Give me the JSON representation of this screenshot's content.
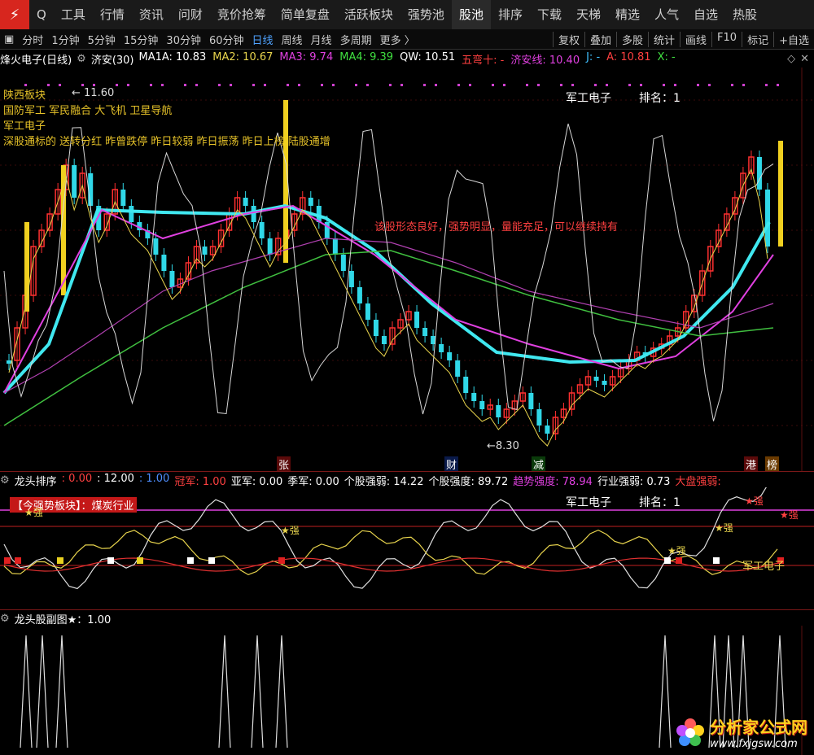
{
  "nav": {
    "logo_glyph": "⚡",
    "search_glyph": "Q",
    "items": [
      "工具",
      "行情",
      "资讯",
      "问财",
      "竞价抢筹",
      "简单复盘",
      "活跃板块",
      "强势池",
      "股池",
      "排序",
      "下载",
      "天梯",
      "精选",
      "人气",
      "自选",
      "热股"
    ],
    "active_index": 8
  },
  "toolbar": {
    "left": [
      "分时",
      "1分钟",
      "5分钟",
      "15分钟",
      "30分钟",
      "60分钟",
      "日线",
      "周线",
      "月线",
      "多周期",
      "更多 〉"
    ],
    "active_index": 6,
    "right": [
      "复权",
      "叠加",
      "多股",
      "统计",
      "画线",
      "F10",
      "标记",
      "+自选"
    ]
  },
  "main": {
    "title": "烽火电子(日线)",
    "indicator": "济安(30)",
    "ma": [
      {
        "label": "MA1A: 10.83",
        "color": "#ffffff"
      },
      {
        "label": "MA2: 10.67",
        "color": "#e8d44d"
      },
      {
        "label": "MA3: 9.74",
        "color": "#e040e0"
      },
      {
        "label": "MA4: 9.39",
        "color": "#40e040"
      },
      {
        "label": "QW: 10.51",
        "color": "#ffffff"
      },
      {
        "label": "五弯十: -",
        "color": "#ff4040"
      },
      {
        "label": "济安线: 10.40",
        "color": "#e040e0"
      },
      {
        "label": "J: -",
        "color": "#40c0ff"
      },
      {
        "label": "A: 10.81",
        "color": "#ff4040"
      },
      {
        "label": "X: -",
        "color": "#40e040"
      }
    ],
    "info_lines": [
      "陕西板块",
      "国防军工 军民融合 大飞机 卫星导航",
      "军工电子",
      "深股通标的 送转分红 昨曾跌停 昨日较弱 昨日振荡 昨日上榜 陆股通增"
    ],
    "sector_label": "军工电子",
    "rank_label": "排名：1",
    "comment": "该股形态良好，强势明显，量能充足，可以继续持有",
    "high_label": "11.60",
    "low_label": "8.30",
    "markers": [
      {
        "text": "张",
        "color": "#ff4040"
      },
      {
        "text": "财",
        "color": "#4f8fff"
      },
      {
        "text": "减",
        "color": "#40e040"
      },
      {
        "text": "港",
        "color": "#ff4040"
      },
      {
        "text": "榜",
        "color": "#ffb000"
      }
    ]
  },
  "panel2": {
    "title": "龙头排序",
    "values": [
      {
        "label": ": 0.00",
        "color": "#ff4040"
      },
      {
        "label": ": 12.00",
        "color": "#ffffff"
      },
      {
        "label": ": 1.00",
        "color": "#4f8fff"
      },
      {
        "label": "冠军: 1.00",
        "color": "#ff4040"
      },
      {
        "label": "亚军: 0.00",
        "color": "#ffffff"
      },
      {
        "label": "季军: 0.00",
        "color": "#ffffff"
      },
      {
        "label": "个股强弱: 14.22",
        "color": "#ffffff"
      },
      {
        "label": "个股强度: 89.72",
        "color": "#ffffff"
      },
      {
        "label": "趋势强度: 78.94",
        "color": "#e040e0"
      },
      {
        "label": "行业强弱: 0.73",
        "color": "#ffffff"
      },
      {
        "label": "大盘强弱:",
        "color": "#ff4040"
      }
    ],
    "sector_tag": "【今强势板块】：煤炭行业",
    "sector_label": "军工电子",
    "rank_label": "排名：1",
    "strong_label": "★强",
    "bottom_label": "军工电子"
  },
  "panel3": {
    "title": "龙头股副图★：1.00"
  },
  "watermark": {
    "site_cn": "分析家公式网",
    "site_url": "www.fxjgsw.com"
  },
  "colors": {
    "up": "#ff3030",
    "down": "#30d8e8",
    "ma_yellow": "#e8d44d",
    "ma_magenta": "#e040e0",
    "ma_green": "#40c040",
    "ma_cyan": "#40e8f0"
  }
}
